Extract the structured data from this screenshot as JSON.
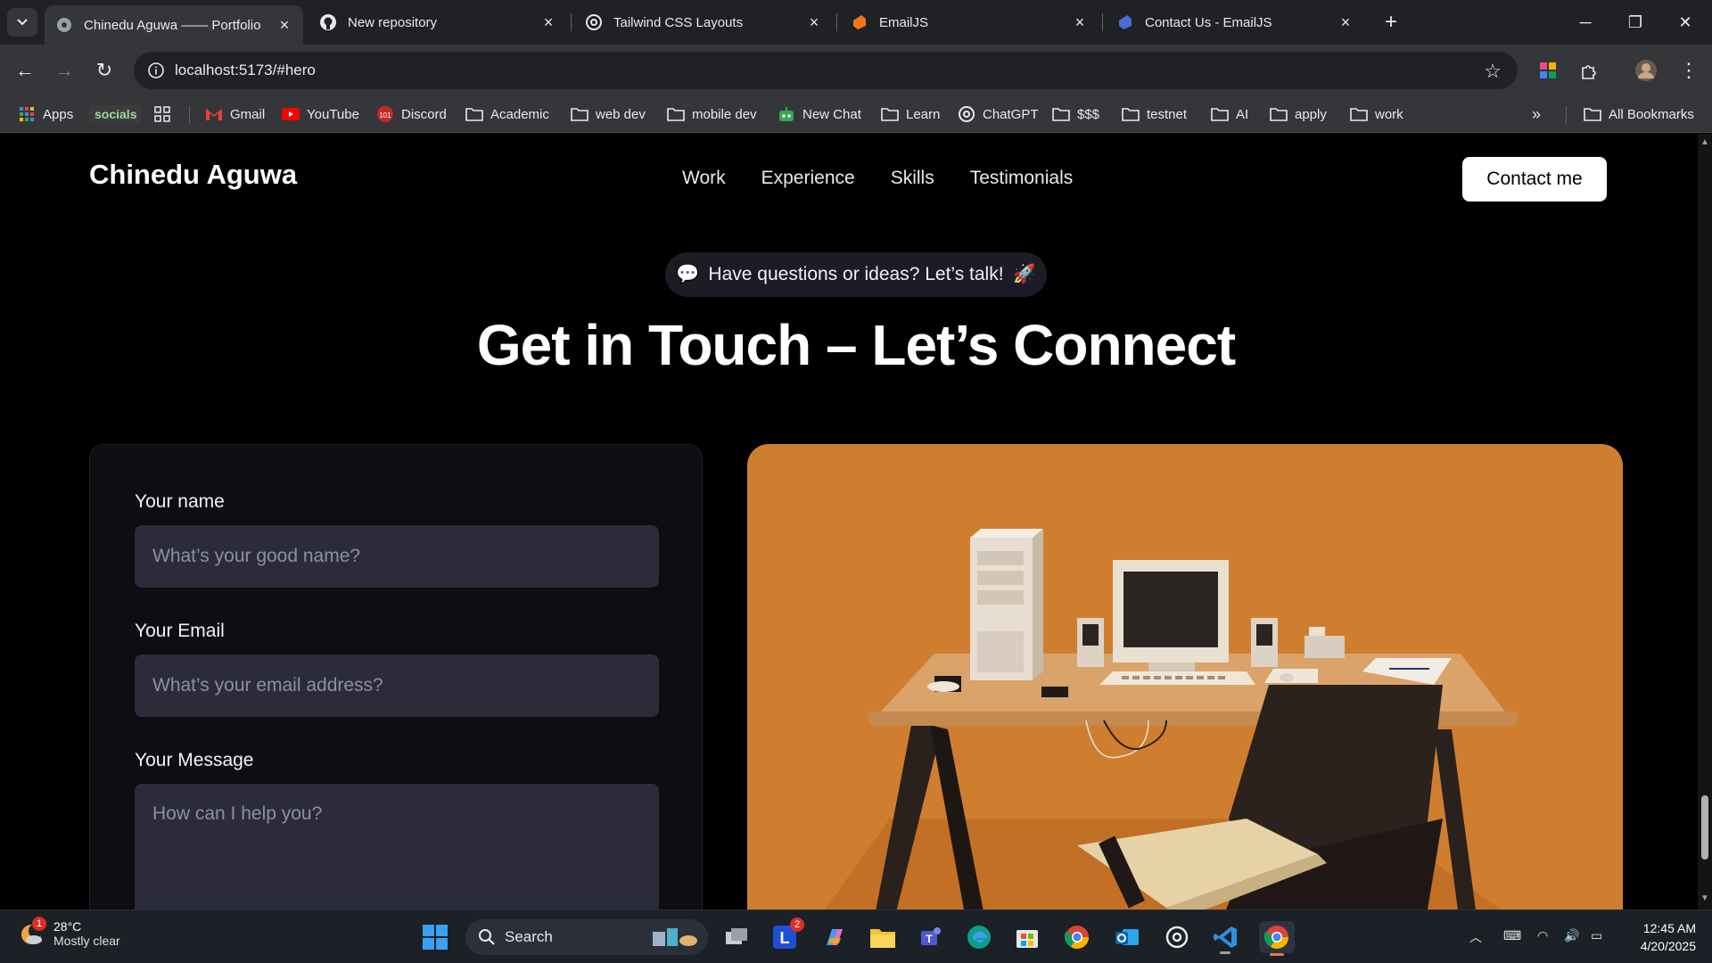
{
  "browser": {
    "tabs": [
      {
        "title": "Chinedu Aguwa —— Portfolio",
        "active": true,
        "icon": "globe-icon"
      },
      {
        "title": "New repository",
        "active": false,
        "icon": "github-icon"
      },
      {
        "title": "Tailwind CSS Layouts",
        "active": false,
        "icon": "openai-icon"
      },
      {
        "title": "EmailJS",
        "active": false,
        "icon": "emailjs-icon"
      },
      {
        "title": "Contact Us - EmailJS",
        "active": false,
        "icon": "emailjs-icon"
      }
    ],
    "url": "localhost:5173/#hero",
    "bookmarks": {
      "apps": "Apps",
      "socials": "socials",
      "gmail": "Gmail",
      "youtube": "YouTube",
      "discord": "Discord",
      "academic": "Academic",
      "web_dev": "web dev",
      "mobile_dev": "mobile dev",
      "new_chat": "New Chat",
      "learn": "Learn",
      "chatgpt": "ChatGPT",
      "money": "$$$",
      "testnet": "testnet",
      "ai": "AI",
      "apply": "apply",
      "work": "work",
      "all_bookmarks": "All Bookmarks"
    }
  },
  "page": {
    "brand": "Chinedu Aguwa",
    "nav": [
      "Work",
      "Experience",
      "Skills",
      "Testimonials"
    ],
    "contact_button": "Contact me",
    "pill_text": "Have questions or ideas? Let’s talk!",
    "pill_emoji_left": "💬",
    "pill_emoji_right": "🚀",
    "headline": "Get in Touch – Let’s Connect",
    "form": {
      "name_label": "Your name",
      "name_placeholder": "What’s your good name?",
      "email_label": "Your Email",
      "email_placeholder": "What’s your email address?",
      "message_label": "Your Message",
      "message_placeholder": "How can I help you?"
    },
    "image_bg": "#cf7e30"
  },
  "taskbar": {
    "weather_temp": "28°C",
    "weather_cond": "Mostly clear",
    "weather_badge": "1",
    "search_label": "Search",
    "teams_badge": "2",
    "time": "12:45 AM",
    "date": "4/20/2025"
  }
}
